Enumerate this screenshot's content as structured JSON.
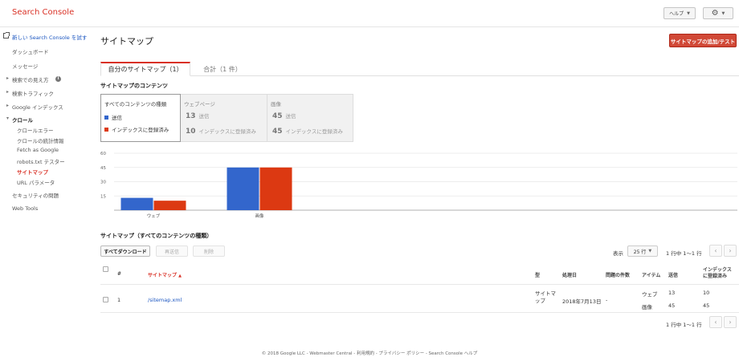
{
  "header": {
    "brand": "Search Console",
    "help_label": "ヘルプ",
    "settings_icon": "gear-icon"
  },
  "sidebar": {
    "try_new": "新しい Search Console を試す",
    "items": [
      {
        "label": "ダッシュボード"
      },
      {
        "label": "メッセージ"
      },
      {
        "label": "検索での見え方"
      },
      {
        "label": "検索トラフィック"
      },
      {
        "label": "Google インデックス"
      },
      {
        "label": "クロール"
      },
      {
        "label": "クロールエラー"
      },
      {
        "label": "クロールの統計情報"
      },
      {
        "label": "Fetch as Google"
      },
      {
        "label": "robots.txt テスター"
      },
      {
        "label": "サイトマップ"
      },
      {
        "label": "URL パラメータ"
      },
      {
        "label": "セキュリティの問題"
      },
      {
        "label": "Web Tools"
      }
    ]
  },
  "main": {
    "title": "サイトマップ",
    "add_test_button": "サイトマップの追加/テスト",
    "tabs": [
      {
        "label": "自分のサイトマップ（1）"
      },
      {
        "label": "合計（1 件）"
      }
    ],
    "contents_title": "サイトマップのコンテンツ",
    "content_tabs": {
      "all": {
        "label": "すべてのコンテンツの種類",
        "legend_submitted": "送信",
        "legend_indexed": "インデックスに登録済み"
      },
      "web": {
        "label": "ウェブページ",
        "submitted_num": "13",
        "submitted_lbl": "送信",
        "indexed_num": "10",
        "indexed_lbl": "インデックスに登録済み"
      },
      "image": {
        "label": "画像",
        "submitted_num": "45",
        "submitted_lbl": "送信",
        "indexed_num": "45",
        "indexed_lbl": "インデックスに登録済み"
      }
    },
    "sitemap_section_title": "サイトマップ（すべてのコンテンツの種類）",
    "toolbar": {
      "download": "すべてダウンロード",
      "resubmit": "再送信",
      "delete": "削除",
      "show_label": "表示",
      "rows_value": "25 行",
      "range_text": "1 行中 1～1 行"
    },
    "table": {
      "headers": {
        "num": "#",
        "sitemap": "サイトマップ",
        "type": "型",
        "processed": "処理日",
        "issues": "問題の件数",
        "item": "アイテム",
        "submitted": "送信",
        "indexed_line1": "インデックス",
        "indexed_line2": "に登録済み"
      },
      "rows": [
        {
          "num": "1",
          "sitemap": "/sitemap.xml",
          "type_line1": "サイトマ",
          "type_line2": "ップ",
          "processed": "2018年7月13日",
          "issues": "-",
          "items": [
            {
              "item": "ウェブ",
              "submitted": "13",
              "indexed": "10"
            },
            {
              "item": "画像",
              "submitted": "45",
              "indexed": "45"
            }
          ]
        }
      ]
    },
    "bottom_range_text": "1 行中 1～1 行"
  },
  "footer": "© 2018 Google LLC - Webmaster Central - 利用規約 - プライバシー ポリシー - Search Console ヘルプ",
  "colors": {
    "submitted": "#3366cc",
    "indexed": "#dc3912",
    "brand": "#d93025",
    "link": "#1a55c0"
  },
  "chart_data": {
    "type": "bar",
    "categories": [
      "ウェブ",
      "画像"
    ],
    "series": [
      {
        "name": "送信",
        "values": [
          13,
          45
        ]
      },
      {
        "name": "インデックスに登録済み",
        "values": [
          10,
          45
        ]
      }
    ],
    "y_ticks": [
      "60",
      "45",
      "30",
      "15"
    ],
    "ylim": [
      0,
      60
    ],
    "grid": true
  }
}
